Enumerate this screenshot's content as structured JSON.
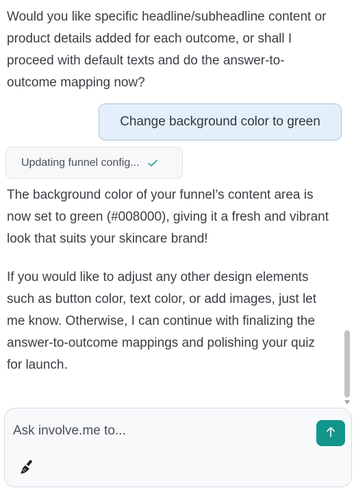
{
  "messages": {
    "intro": "Would you like specific headline/subheadline content or product details added for each outcome, or shall I proceed with default texts and do the answer-to-outcome mapping now?",
    "user": "Change background color to green",
    "status": "Updating funnel config...",
    "reply_1": "The background color of your funnel’s content area is now set to green (#008000), giving it a fresh and vibrant look that suits your skincare brand!",
    "reply_2": "If you would like to adjust any other design elements such as button color, text color, or add images, just let me know. Otherwise, I can continue with finalizing the answer-to-outcome mappings and polishing your quiz for launch."
  },
  "composer": {
    "placeholder": "Ask involve.me to..."
  },
  "icons": {
    "status": "check-icon",
    "send": "arrow-up-icon",
    "tool": "brush-icon"
  },
  "colors": {
    "accent": "#12958b",
    "user_bubble_bg": "#e3f0fb",
    "user_bubble_border": "#a9c4da",
    "status_check": "#2e9a80"
  }
}
